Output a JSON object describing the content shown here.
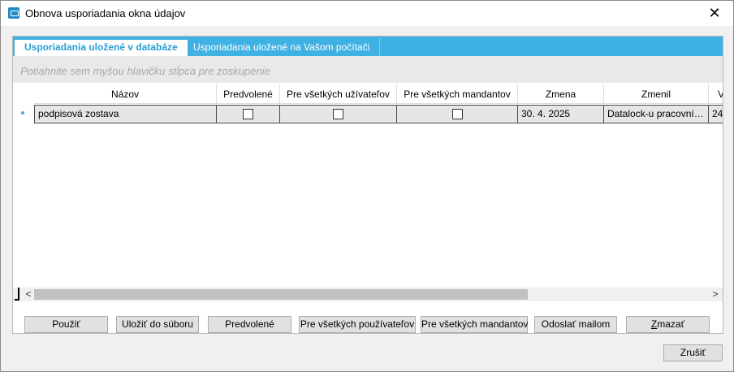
{
  "window": {
    "title": "Obnova usporiadania okna údajov",
    "close_glyph": "✕"
  },
  "tabs": [
    {
      "label": "Usporiadania uložené v databáze",
      "active": true
    },
    {
      "label": "Usporiadania uložené na Vašom počítači",
      "active": false
    }
  ],
  "group_hint": "Potiahnite sem myšou hlavičku stĺpca pre zoskupenie",
  "table": {
    "columns": [
      "Názov",
      "Predvolené",
      "Pre všetkých užívateľov",
      "Pre všetkých mandantov",
      "Zmena",
      "Zmenil",
      "V"
    ],
    "rows": [
      {
        "nazov": "podpisová zostava",
        "predvolene": false,
        "pre_vsetkych_uzivatelov": false,
        "pre_vsetkych_mandantov": false,
        "zmena": "30. 4. 2025",
        "zmenil": "Datalock-u  pracovní…",
        "v": "24"
      }
    ]
  },
  "scrollbar": {
    "left_arrow": "<",
    "right_arrow": ">"
  },
  "buttons": {
    "pouzit": "Použiť",
    "ulozit": "Uložiť do súboru",
    "predvolene": "Predvolené",
    "vsetkych_pouzivatelov": "Pre všetkých používateľov",
    "vsetkych_mandantov": "Pre všetkých mandantov",
    "odoslat": "Odoslať mailom",
    "zmazat_underlined": "Z",
    "zmazat_rest": "mazať",
    "zrusit": "Zrušiť"
  },
  "colors": {
    "accent": "#3fb1e3",
    "tab_active_text": "#2a9fd6",
    "selected_row": "#e6e6e6"
  }
}
